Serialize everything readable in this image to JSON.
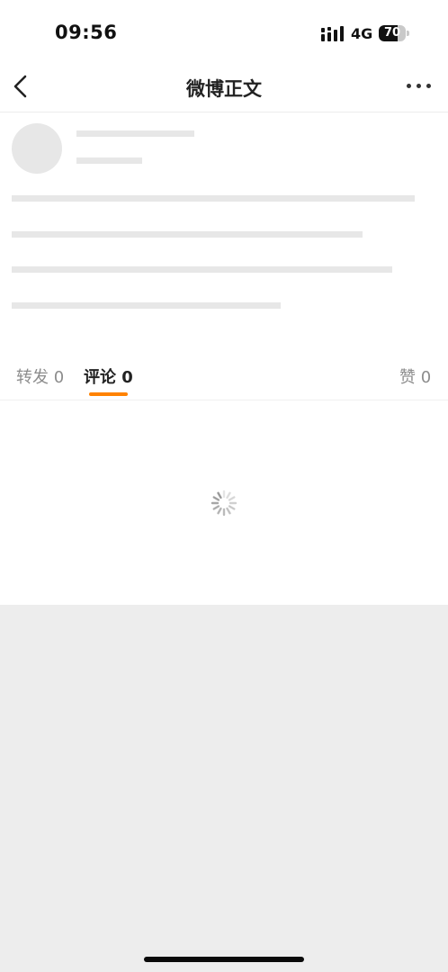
{
  "status_bar": {
    "time": "09:56",
    "network": "4G",
    "battery": "70",
    "battery_level_pct": 70
  },
  "nav": {
    "title": "微博正文"
  },
  "tabs": [
    {
      "label": "转发 0",
      "active": false
    },
    {
      "label": "评论 0",
      "active": true
    },
    {
      "label": "赞 0",
      "active": false
    }
  ],
  "colors": {
    "accent": "#ff8200",
    "background": "#ededed",
    "skeleton": "#e7e7e7"
  }
}
